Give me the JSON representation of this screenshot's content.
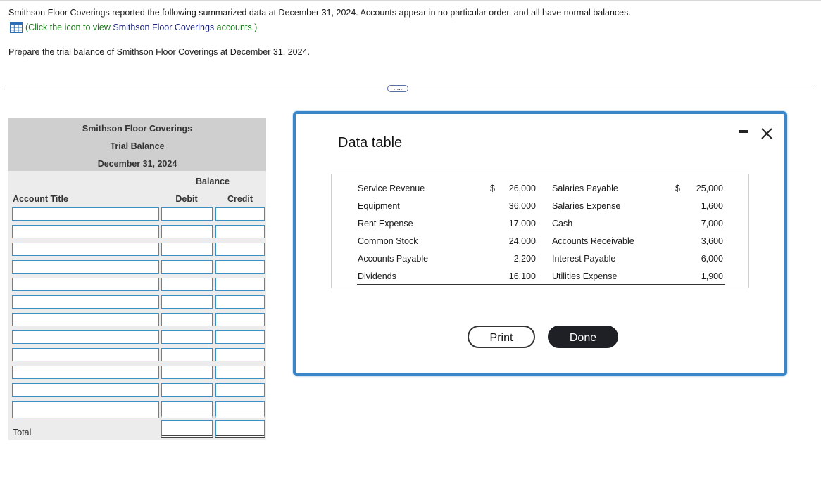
{
  "question": {
    "intro": "Smithson Floor Coverings reported the following summarized data at December 31, 2024. Accounts appear in no particular order, and all have normal balances.",
    "link_prefix": "(Click the icon to view ",
    "link_company": "Smithson Floor Coverings",
    "link_suffix": " accounts.)",
    "prepare": "Prepare the trial balance of Smithson Floor Coverings at December 31, 2024.",
    "expand_label": "....."
  },
  "trial_balance": {
    "company": "Smithson Floor Coverings",
    "title": "Trial Balance",
    "date": "December 31, 2024",
    "balance_header": "Balance",
    "col_account": "Account Title",
    "col_debit": "Debit",
    "col_credit": "Credit",
    "total_label": "Total",
    "row_count": 12
  },
  "data_table": {
    "title": "Data table",
    "rows": [
      {
        "acct1": "Service Revenue",
        "sym1": "$",
        "amt1": "26,000",
        "acct2": "Salaries Payable",
        "sym2": "$",
        "amt2": "25,000"
      },
      {
        "acct1": "Equipment",
        "sym1": "",
        "amt1": "36,000",
        "acct2": "Salaries Expense",
        "sym2": "",
        "amt2": "1,600"
      },
      {
        "acct1": "Rent Expense",
        "sym1": "",
        "amt1": "17,000",
        "acct2": "Cash",
        "sym2": "",
        "amt2": "7,000"
      },
      {
        "acct1": "Common Stock",
        "sym1": "",
        "amt1": "24,000",
        "acct2": "Accounts Receivable",
        "sym2": "",
        "amt2": "3,600"
      },
      {
        "acct1": "Accounts Payable",
        "sym1": "",
        "amt1": "2,200",
        "acct2": "Interest Payable",
        "sym2": "",
        "amt2": "6,000"
      },
      {
        "acct1": "Dividends",
        "sym1": "",
        "amt1": "16,100",
        "acct2": "Utilities Expense",
        "sym2": "",
        "amt2": "1,900"
      }
    ],
    "print_label": "Print",
    "done_label": "Done",
    "minimize_icon": "minimize-icon",
    "close_icon": "close-icon"
  }
}
